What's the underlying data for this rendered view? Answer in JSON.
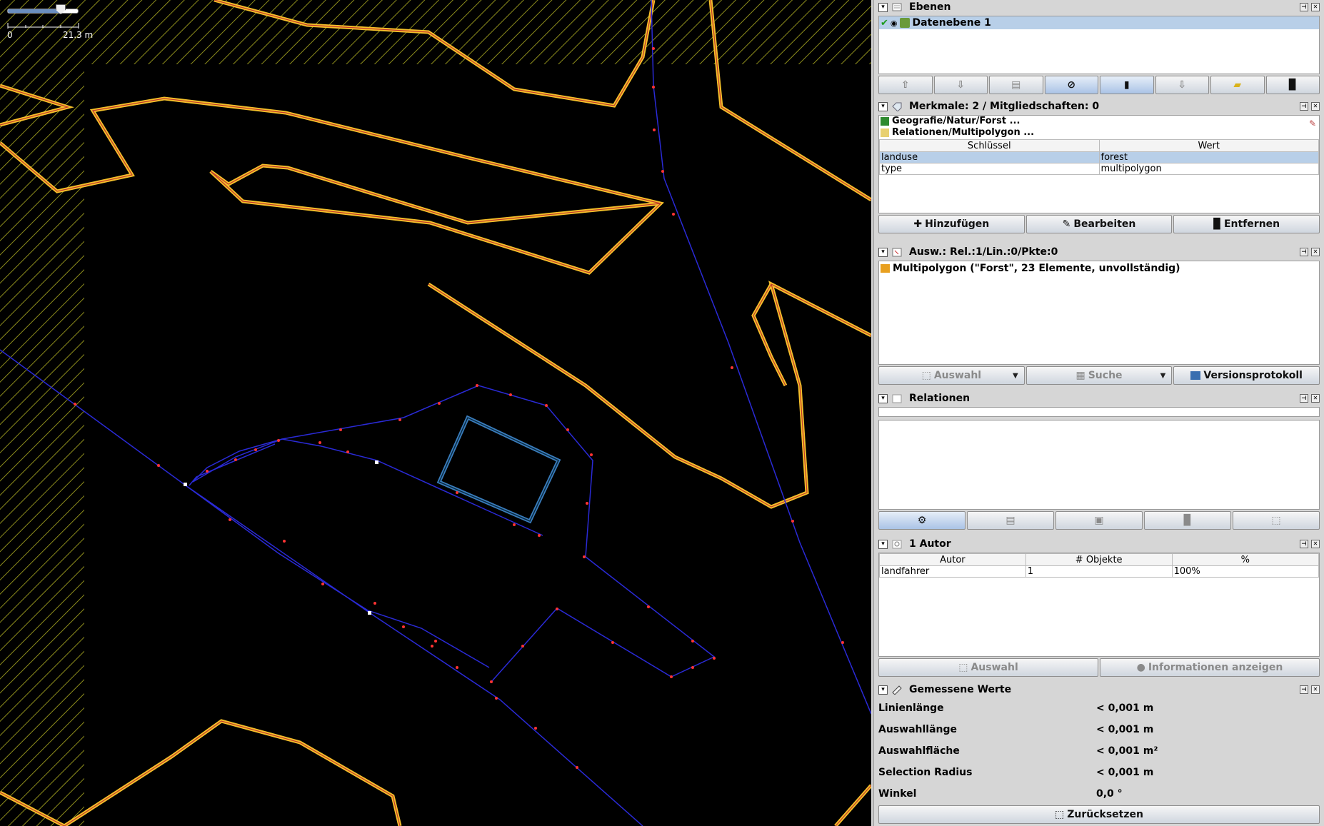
{
  "map": {
    "scale_start": "0",
    "scale_end": "21.3 m",
    "zoom_slider": 0.75
  },
  "layers": {
    "title": "Ebenen",
    "items": [
      {
        "label": "Datenebene 1",
        "active": true,
        "visible": true
      }
    ]
  },
  "tags": {
    "title": "Merkmale: 2 / Mitgliedschaften: 0",
    "presets": [
      "Geografie/Natur/Forst ...",
      "Relationen/Multipolygon ..."
    ],
    "col_key": "Schlüssel",
    "col_value": "Wert",
    "rows": [
      {
        "key": "landuse",
        "value": "forest"
      },
      {
        "key": "type",
        "value": "multipolygon"
      }
    ],
    "add": "Hinzufügen",
    "edit": "Bearbeiten",
    "remove": "Entfernen"
  },
  "selection": {
    "title": "Ausw.: Rel.:1/Lin.:0/Pkte:0",
    "items": [
      "Multipolygon (\"Forst\", 23 Elemente, unvollständig)"
    ],
    "select": "Auswahl",
    "search": "Suche",
    "history": "Versionsprotokoll"
  },
  "relations": {
    "title": "Relationen"
  },
  "authors": {
    "title": "1 Autor",
    "col_author": "Autor",
    "col_objects": "# Objekte",
    "col_percent": "%",
    "rows": [
      {
        "author": "landfahrer",
        "objects": "1",
        "percent": "100%"
      }
    ],
    "select": "Auswahl",
    "info": "Informationen anzeigen"
  },
  "measure": {
    "title": "Gemessene Werte",
    "rows": [
      {
        "label": "Linienlänge",
        "value": "< 0,001 m"
      },
      {
        "label": "Auswahllänge",
        "value": "< 0,001 m"
      },
      {
        "label": "Auswahlfläche",
        "value": "< 0,001 m²"
      },
      {
        "label": "Selection Radius",
        "value": "< 0,001 m"
      },
      {
        "label": "Winkel",
        "value": "0,0 °"
      }
    ],
    "reset": "Zurücksetzen"
  },
  "colors": {
    "forest_outline": "#f5c02a",
    "forest_inner": "#c0392b",
    "selected_way": "#2a2ad6",
    "building": "#3a7dbd",
    "hatch": "#9a9a20"
  }
}
